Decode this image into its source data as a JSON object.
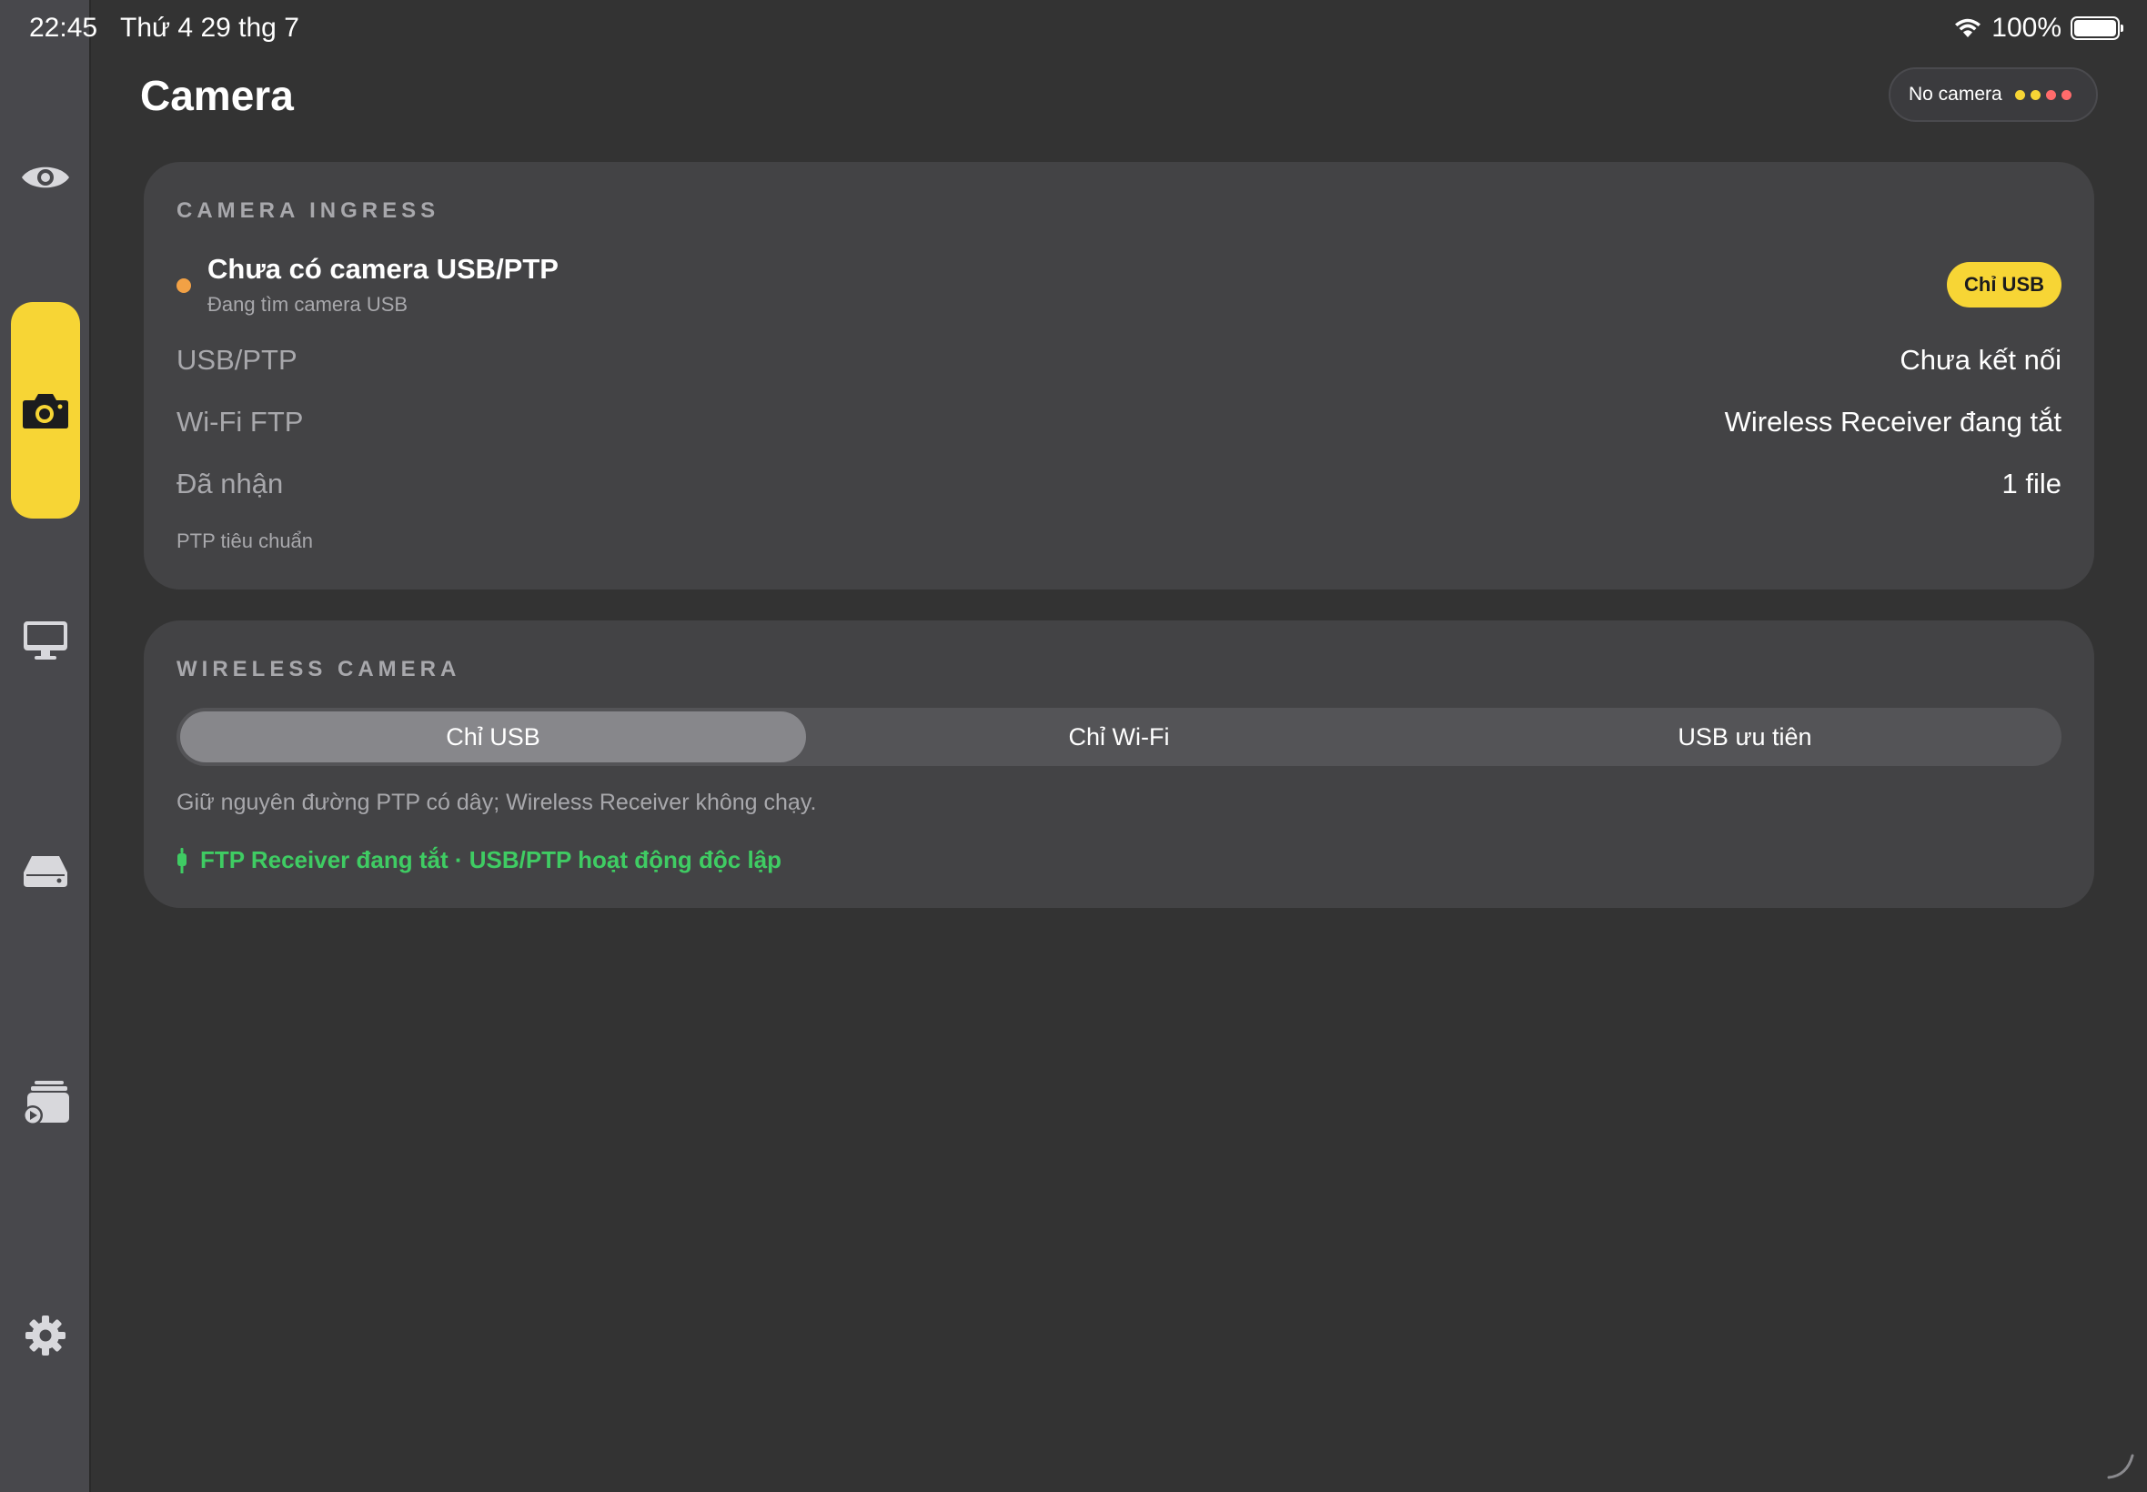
{
  "status_bar": {
    "time": "22:45",
    "date": "Thứ 4 29 thg 7",
    "battery": "100%",
    "wifi_icon": "wifi-icon",
    "battery_level": 1.0
  },
  "sidebar": {
    "items": [
      {
        "icon": "eye-icon",
        "active": false
      },
      {
        "icon": "camera-icon",
        "active": true
      },
      {
        "icon": "monitor-icon",
        "active": false
      },
      {
        "icon": "drive-icon",
        "active": false
      },
      {
        "icon": "media-stack-icon",
        "active": false
      },
      {
        "icon": "gear-icon",
        "active": false
      }
    ],
    "accent_color": "#f7d535"
  },
  "header": {
    "title": "Camera",
    "camera_status": "No camera",
    "status_dots": [
      "#f7d535",
      "#f7d535",
      "#ff6b6b",
      "#ff6b6b"
    ]
  },
  "ingress": {
    "section_title": "CAMERA INGRESS",
    "status_title": "Chưa có camera USB/PTP",
    "status_subtitle": "Đang tìm camera USB",
    "status_color": "#f2a145",
    "mode_badge": "Chỉ USB",
    "rows": [
      {
        "label": "USB/PTP",
        "value": "Chưa kết nối"
      },
      {
        "label": "Wi-Fi FTP",
        "value": "Wireless Receiver đang tắt"
      },
      {
        "label": "Đã nhận",
        "value": "1 file"
      }
    ],
    "note": "PTP tiêu chuẩn"
  },
  "wireless": {
    "section_title": "WIRELESS CAMERA",
    "segments": [
      {
        "label": "Chỉ USB",
        "selected": true
      },
      {
        "label": "Chỉ Wi-Fi",
        "selected": false
      },
      {
        "label": "USB ưu tiên",
        "selected": false
      }
    ],
    "description": "Giữ nguyên đường PTP có dây; Wireless Receiver không chạy.",
    "ftp_status": "FTP Receiver đang tắt · USB/PTP hoạt động độc lập",
    "ftp_status_color": "#3fcc63",
    "ftp_icon": "plug-icon"
  }
}
